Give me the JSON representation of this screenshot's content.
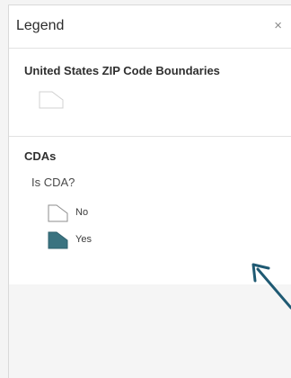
{
  "panel": {
    "title": "Legend",
    "close_glyph": "×"
  },
  "layers": [
    {
      "title": "United States ZIP Code Boundaries",
      "symbol_icon": "polygon-outline-icon",
      "symbol_color": "#ffffff"
    },
    {
      "title": "CDAs",
      "field": "Is CDA?",
      "classes": [
        {
          "label": "No",
          "symbol_icon": "polygon-outline-icon",
          "symbol_color": "#ffffff"
        },
        {
          "label": "Yes",
          "symbol_icon": "polygon-filled-icon",
          "symbol_color": "#3a7380"
        }
      ]
    }
  ],
  "colors": {
    "arrow": "#1f5a73",
    "symbol_outline": "#9a9a9a"
  }
}
